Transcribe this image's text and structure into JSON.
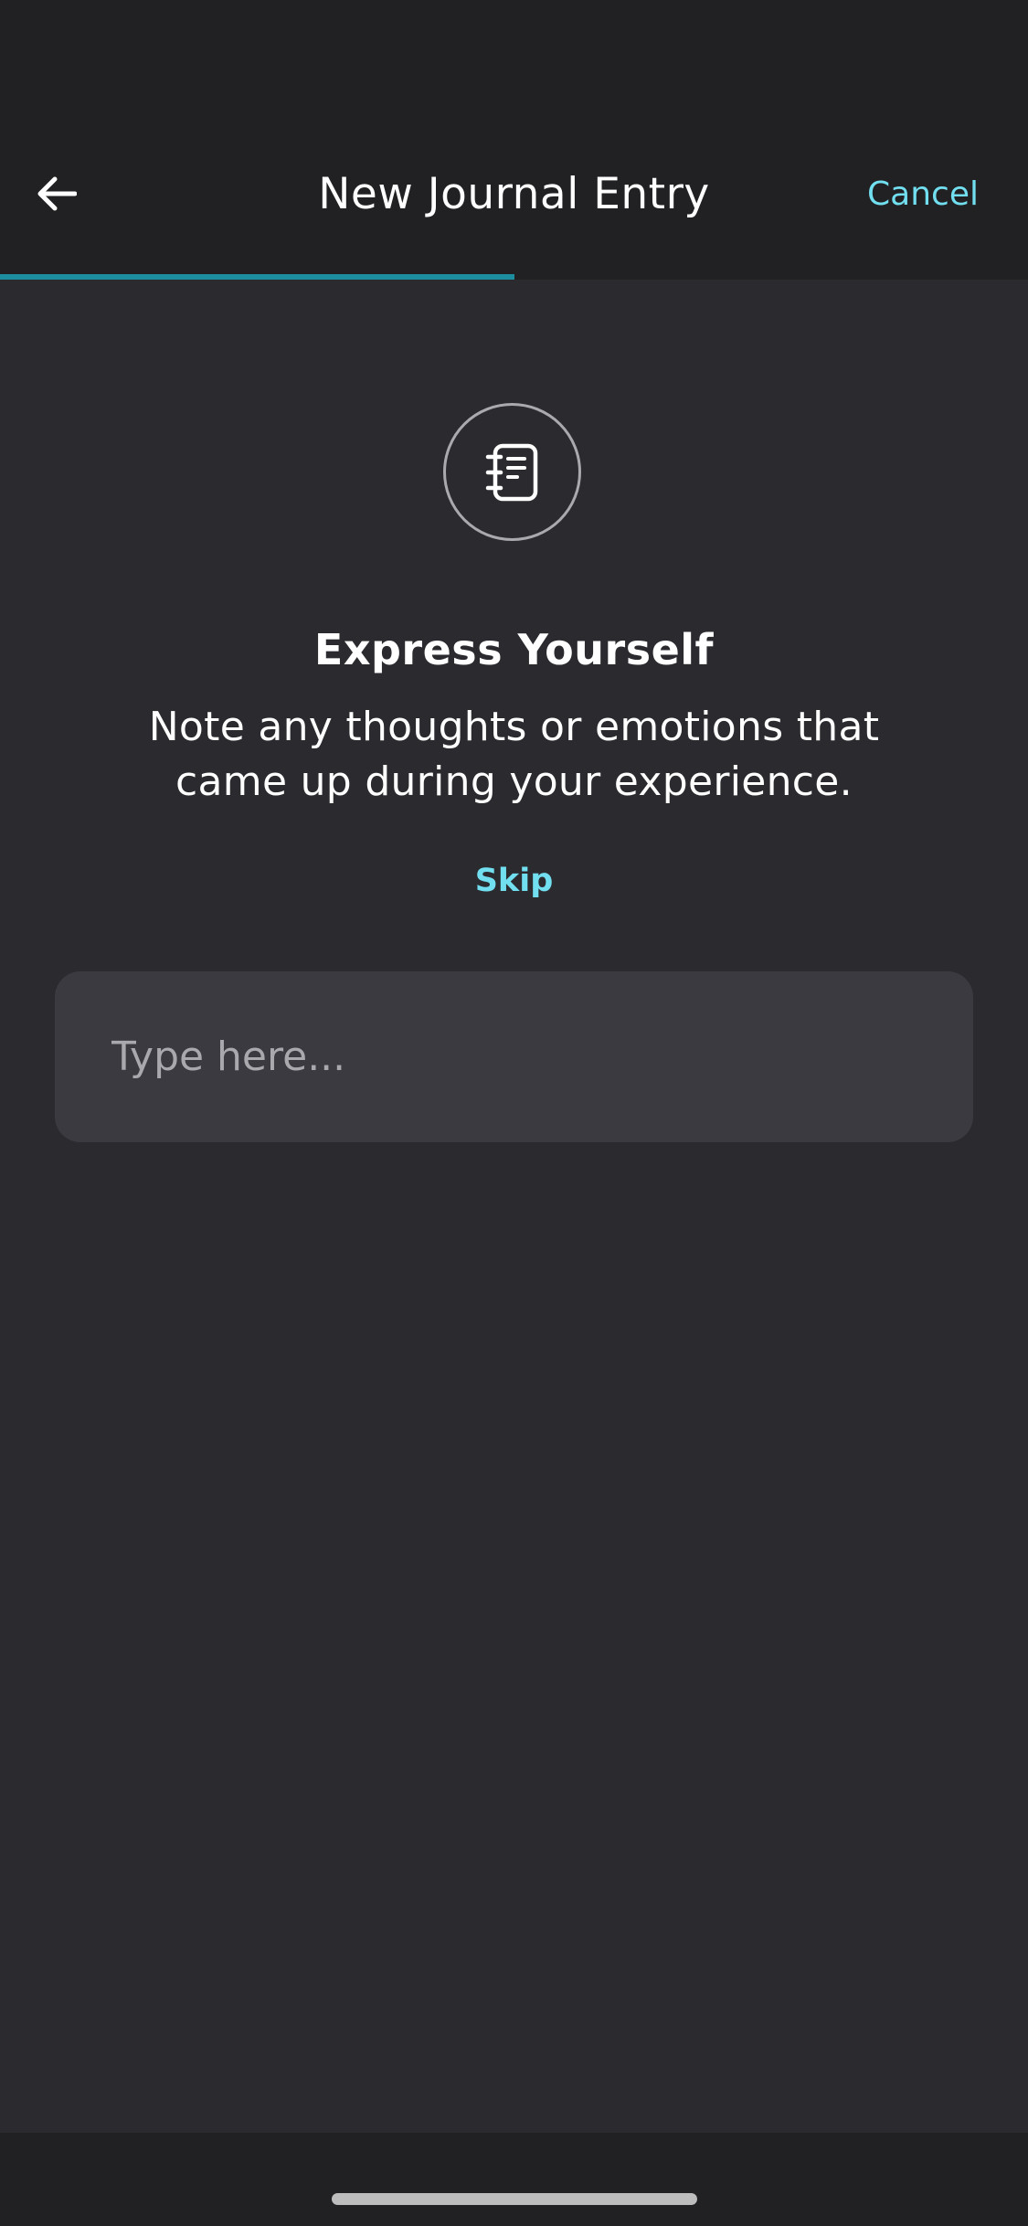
{
  "header": {
    "title": "New Journal Entry",
    "cancel_label": "Cancel",
    "back_icon": "arrow-left-icon"
  },
  "progress": {
    "fraction": 0.5,
    "color": "#1d8ea0"
  },
  "prompt": {
    "icon": "journal-notebook-icon",
    "heading": "Express Yourself",
    "description": "Note any thoughts or emotions that came up during your experience.",
    "skip_label": "Skip"
  },
  "entry": {
    "value": "",
    "placeholder": "Type here..."
  },
  "colors": {
    "accent": "#72dff0",
    "background": "#2a2a2f",
    "bar_background": "#212124",
    "field_background": "#3a3a40"
  }
}
